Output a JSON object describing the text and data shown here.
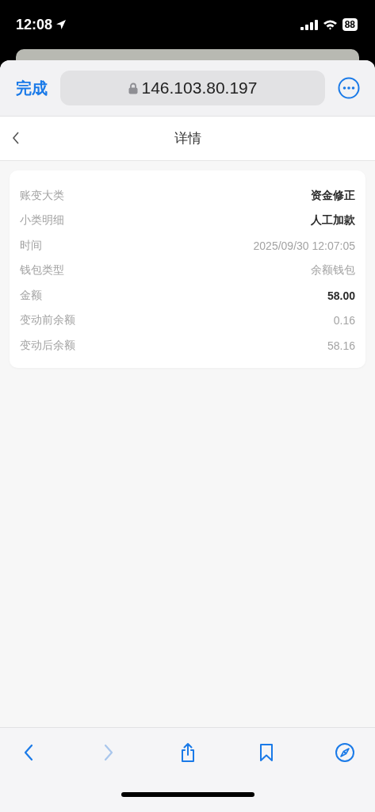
{
  "status_bar": {
    "time": "12:08",
    "battery": "88"
  },
  "browser": {
    "done": "完成",
    "url": "146.103.80.197"
  },
  "page": {
    "title": "详情"
  },
  "details": [
    {
      "label": "账变大类",
      "value": "资金修正",
      "kind": "emphasis"
    },
    {
      "label": "小类明细",
      "value": "人工加款",
      "kind": "emphasis"
    },
    {
      "label": "时间",
      "value": "2025/09/30 12:07:05",
      "kind": "plain"
    },
    {
      "label": "钱包类型",
      "value": "余额钱包",
      "kind": "plain"
    },
    {
      "label": "金额",
      "value": "58.00",
      "kind": "emphasis"
    },
    {
      "label": "变动前余额",
      "value": "0.16",
      "kind": "plain"
    },
    {
      "label": "变动后余额",
      "value": "58.16",
      "kind": "plain"
    }
  ],
  "toolbar": [
    {
      "kind": "back",
      "disabled": false
    },
    {
      "kind": "forward",
      "disabled": true
    },
    {
      "kind": "share",
      "disabled": false
    },
    {
      "kind": "bookmarks",
      "disabled": false
    },
    {
      "kind": "compass",
      "disabled": false
    }
  ]
}
